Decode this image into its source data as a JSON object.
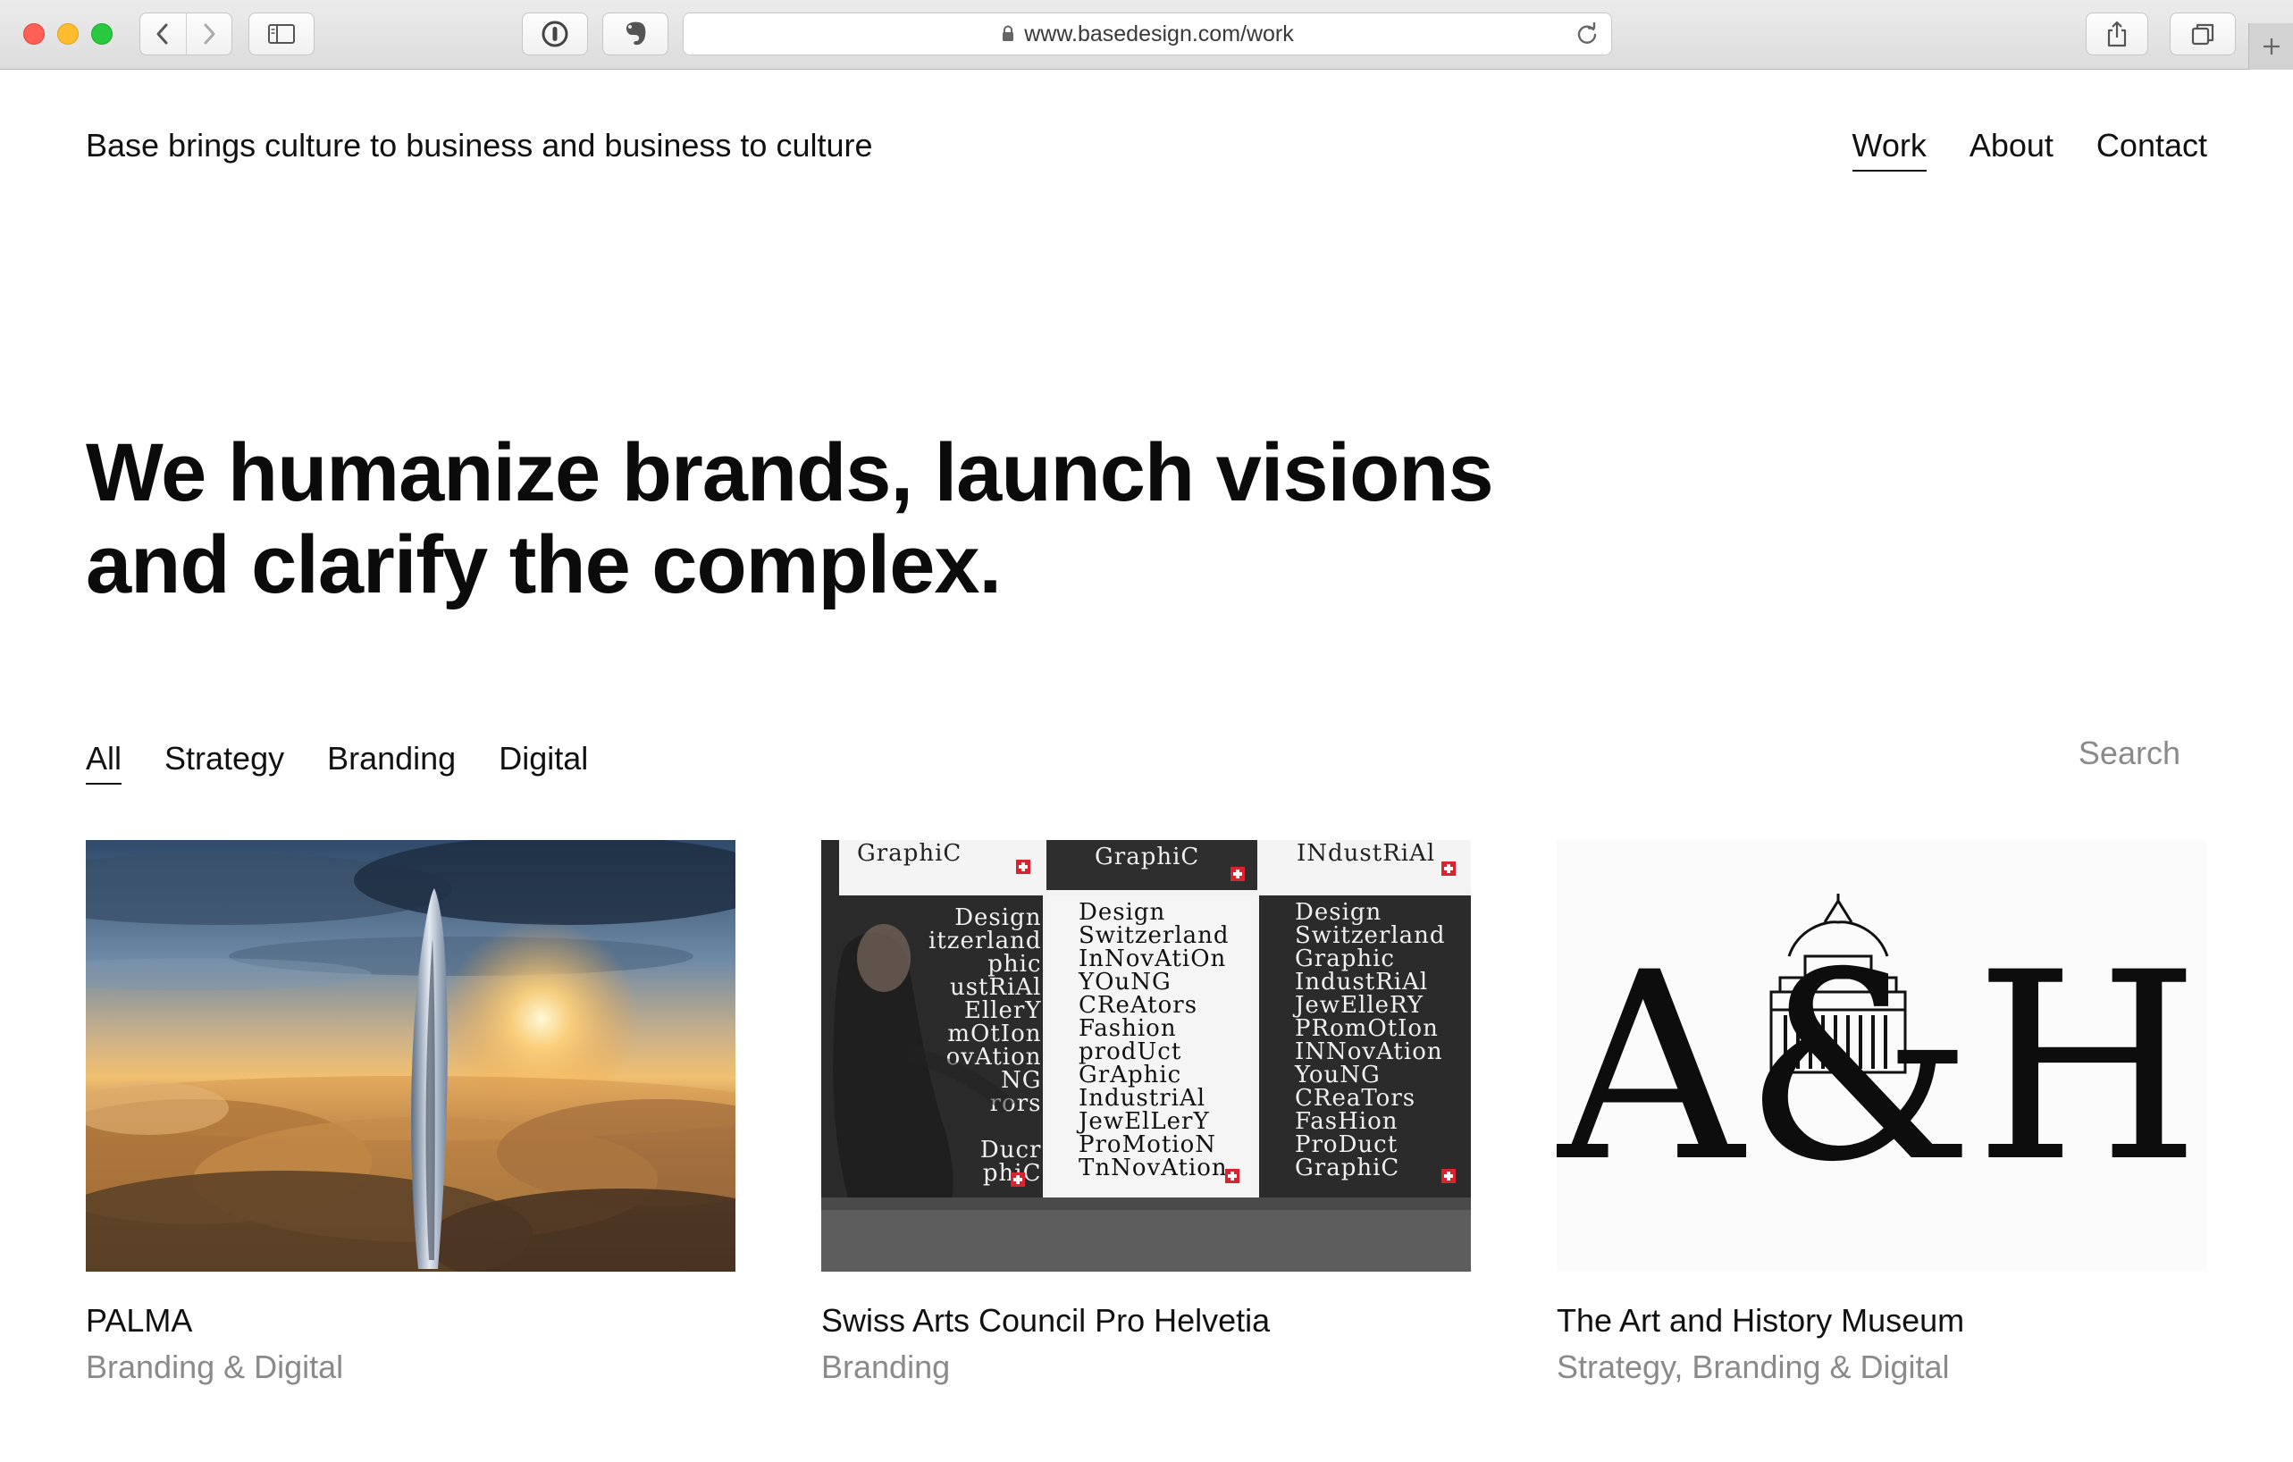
{
  "browser": {
    "url": "www.basedesign.com/work"
  },
  "header": {
    "tagline": "Base brings culture to business and business to culture",
    "nav": [
      "Work",
      "About",
      "Contact"
    ],
    "active_nav": "Work"
  },
  "hero": {
    "line1": "We humanize brands, launch visions",
    "line2": "and clarify the complex."
  },
  "filters": {
    "items": [
      "All",
      "Strategy",
      "Branding",
      "Digital"
    ],
    "active": "All",
    "search_placeholder": "Search"
  },
  "projects": [
    {
      "title": "PALMA",
      "categories": "Branding & Digital"
    },
    {
      "title": "Swiss Arts Council Pro Helvetia",
      "categories": "Branding"
    },
    {
      "title": "The Art and History Museum",
      "categories": "Strategy, Branding & Digital"
    }
  ],
  "artwork": {
    "poster_left": "Design\nitzerland\nphic\nustRiAl\nEllerY\nmOtIon\novAtion\nNG\nrors\n\nDucr\nphiC",
    "poster_middle": "Design\nSwitzerland\nInNovAtiOn\nYOuNG\nCReAtors\nFashion\nprodUct\nGrAphic\nIndustriAl\nJewElLerY\nProMotioN\nTnNovAtion",
    "poster_right": "Design\nSwitzerland\nGraphic\nIndustRiAl\nJewElleRY\nPRomOtIon\nINNovAtion\nYouNG\nCReaTors\nFasHion\nProDuct\nGraphiC",
    "poster_top_left": "GraphiC",
    "poster_top_middle": "GraphiC",
    "poster_top_right": "INdustRiAl",
    "museum_logo": "A&H"
  },
  "colors": {
    "text": "#111111",
    "muted": "#8a8a8a",
    "background": "#ffffff"
  }
}
